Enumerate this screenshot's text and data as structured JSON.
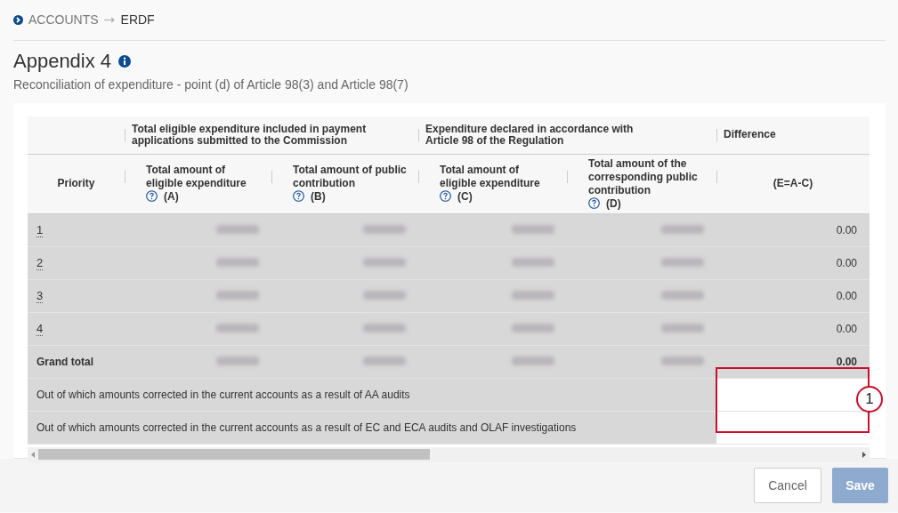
{
  "breadcrumb": {
    "items": [
      {
        "label": "ACCOUNTS",
        "selected": false
      },
      {
        "label": "ERDF",
        "selected": true
      }
    ]
  },
  "page": {
    "title": "Appendix 4",
    "subtitle": "Reconciliation of expenditure - point (d) of Article 98(3) and Article 98(7)"
  },
  "table": {
    "group_headers": [
      {
        "label": "Total eligible expenditure included in payment applications submitted to the Commission"
      },
      {
        "label": "Expenditure declared in accordance with Article 98 of the Regulation"
      },
      {
        "label": "Difference"
      }
    ],
    "columns": [
      {
        "label": "Priority",
        "help": false
      },
      {
        "label": "Total amount of eligible expenditure",
        "help": true,
        "code": "(A)"
      },
      {
        "label": "Total amount of public contribution",
        "help": true,
        "code": "(B)"
      },
      {
        "label": "Total amount of eligible expenditure",
        "help": true,
        "code": "(C)"
      },
      {
        "label": "Total amount of the corresponding public contribution",
        "help": true,
        "code": "(D)"
      },
      {
        "label": "(E=A-C)",
        "help": false
      }
    ],
    "rows": [
      {
        "kind": "priority",
        "label": "1",
        "cells": [
          {
            "kind": "blurred"
          },
          {
            "kind": "blurred"
          },
          {
            "kind": "blurred"
          },
          {
            "kind": "blurred"
          },
          {
            "kind": "text",
            "text": "0.00"
          }
        ]
      },
      {
        "kind": "priority",
        "label": "2",
        "cells": [
          {
            "kind": "blurred"
          },
          {
            "kind": "blurred"
          },
          {
            "kind": "blurred"
          },
          {
            "kind": "blurred"
          },
          {
            "kind": "text",
            "text": "0.00"
          }
        ]
      },
      {
        "kind": "priority",
        "label": "3",
        "cells": [
          {
            "kind": "blurred"
          },
          {
            "kind": "blurred"
          },
          {
            "kind": "blurred"
          },
          {
            "kind": "blurred"
          },
          {
            "kind": "text",
            "text": "0.00"
          }
        ]
      },
      {
        "kind": "priority",
        "label": "4",
        "cells": [
          {
            "kind": "blurred"
          },
          {
            "kind": "blurred"
          },
          {
            "kind": "blurred"
          },
          {
            "kind": "blurred"
          },
          {
            "kind": "text",
            "text": "0.00"
          }
        ]
      },
      {
        "kind": "total",
        "label": "Grand total",
        "cells": [
          {
            "kind": "blurred"
          },
          {
            "kind": "blurred"
          },
          {
            "kind": "blurred"
          },
          {
            "kind": "blurred"
          },
          {
            "kind": "text",
            "text": "0.00"
          }
        ]
      },
      {
        "kind": "correction",
        "label": "Out of which amounts corrected in the current accounts as a result of AA audits",
        "cells": [
          {
            "kind": "input"
          }
        ]
      },
      {
        "kind": "correction",
        "label": "Out of which amounts corrected in the current accounts as a result of EC and ECA audits and OLAF investigations",
        "cells": [
          {
            "kind": "input"
          }
        ]
      }
    ]
  },
  "annotation": {
    "marker": "1"
  },
  "buttons": [
    {
      "label": "Cancel",
      "kind": "secondary",
      "disabled": false
    },
    {
      "label": "Save",
      "kind": "primary",
      "disabled": true
    }
  ]
}
